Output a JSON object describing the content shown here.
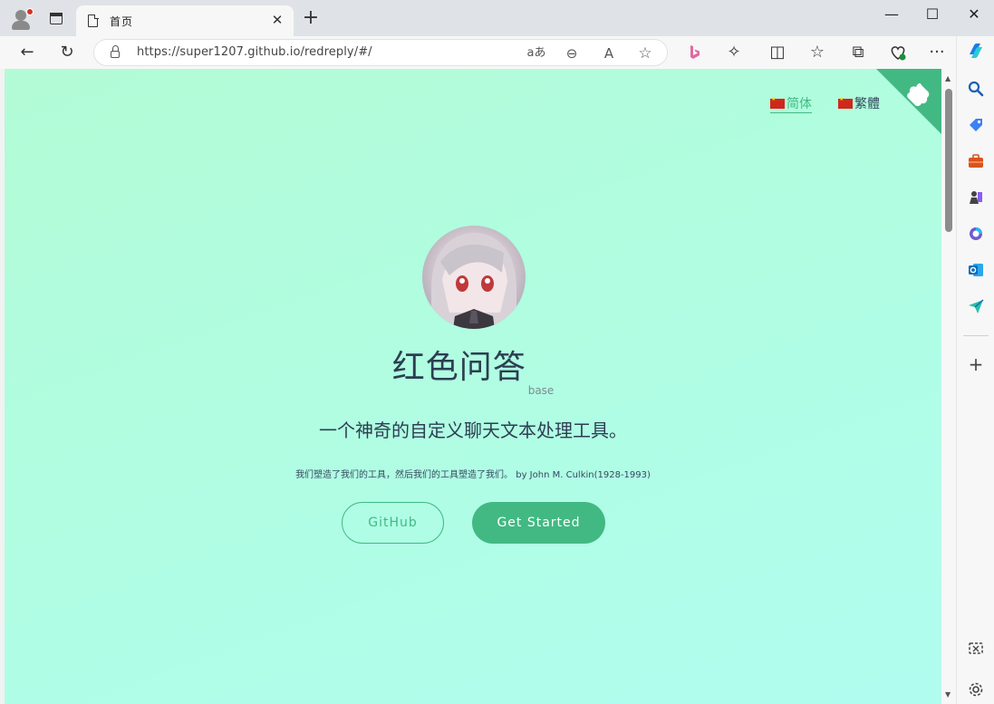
{
  "browser": {
    "tab_title": "首页",
    "close_glyph": "✕",
    "newtab_glyph": "+",
    "url": "https://super1207.github.io/redreply/#/",
    "window_controls": {
      "minimize": "—",
      "maximize": "☐",
      "close": "✕"
    },
    "nav": {
      "back": "←",
      "reload": "↻"
    },
    "omnibox_buttons": {
      "read_aloud_lang": "aあ",
      "zoom": "⊖",
      "read_aloud": "A",
      "favorite": "☆"
    },
    "toolbar_buttons": {
      "extensions": "✧",
      "split": "◫",
      "favorites": "☆",
      "collections": "⧉",
      "more": "···"
    },
    "accent": "#42b983"
  },
  "page": {
    "langs": [
      {
        "label": "简体",
        "active": true
      },
      {
        "label": "繁體",
        "active": false
      }
    ],
    "title": "红色问答",
    "title_suffix": "base",
    "tagline": "一个神奇的自定义聊天文本处理工具。",
    "quote": "我们塑造了我们的工具，然后我们的工具塑造了我们。 by John M. Culkin(1928-1993)",
    "buttons": {
      "github": "GitHub",
      "start": "Get Started"
    }
  },
  "scrollbar": {
    "up": "▲",
    "down": "▼"
  },
  "sidebar_icons": [
    "copilot-icon",
    "search-icon",
    "tag-icon",
    "briefcase-icon",
    "games-icon",
    "office-icon",
    "outlook-icon",
    "send-icon",
    "add-icon",
    "screenshot-icon",
    "settings-icon"
  ],
  "sidebar_add_glyph": "+"
}
